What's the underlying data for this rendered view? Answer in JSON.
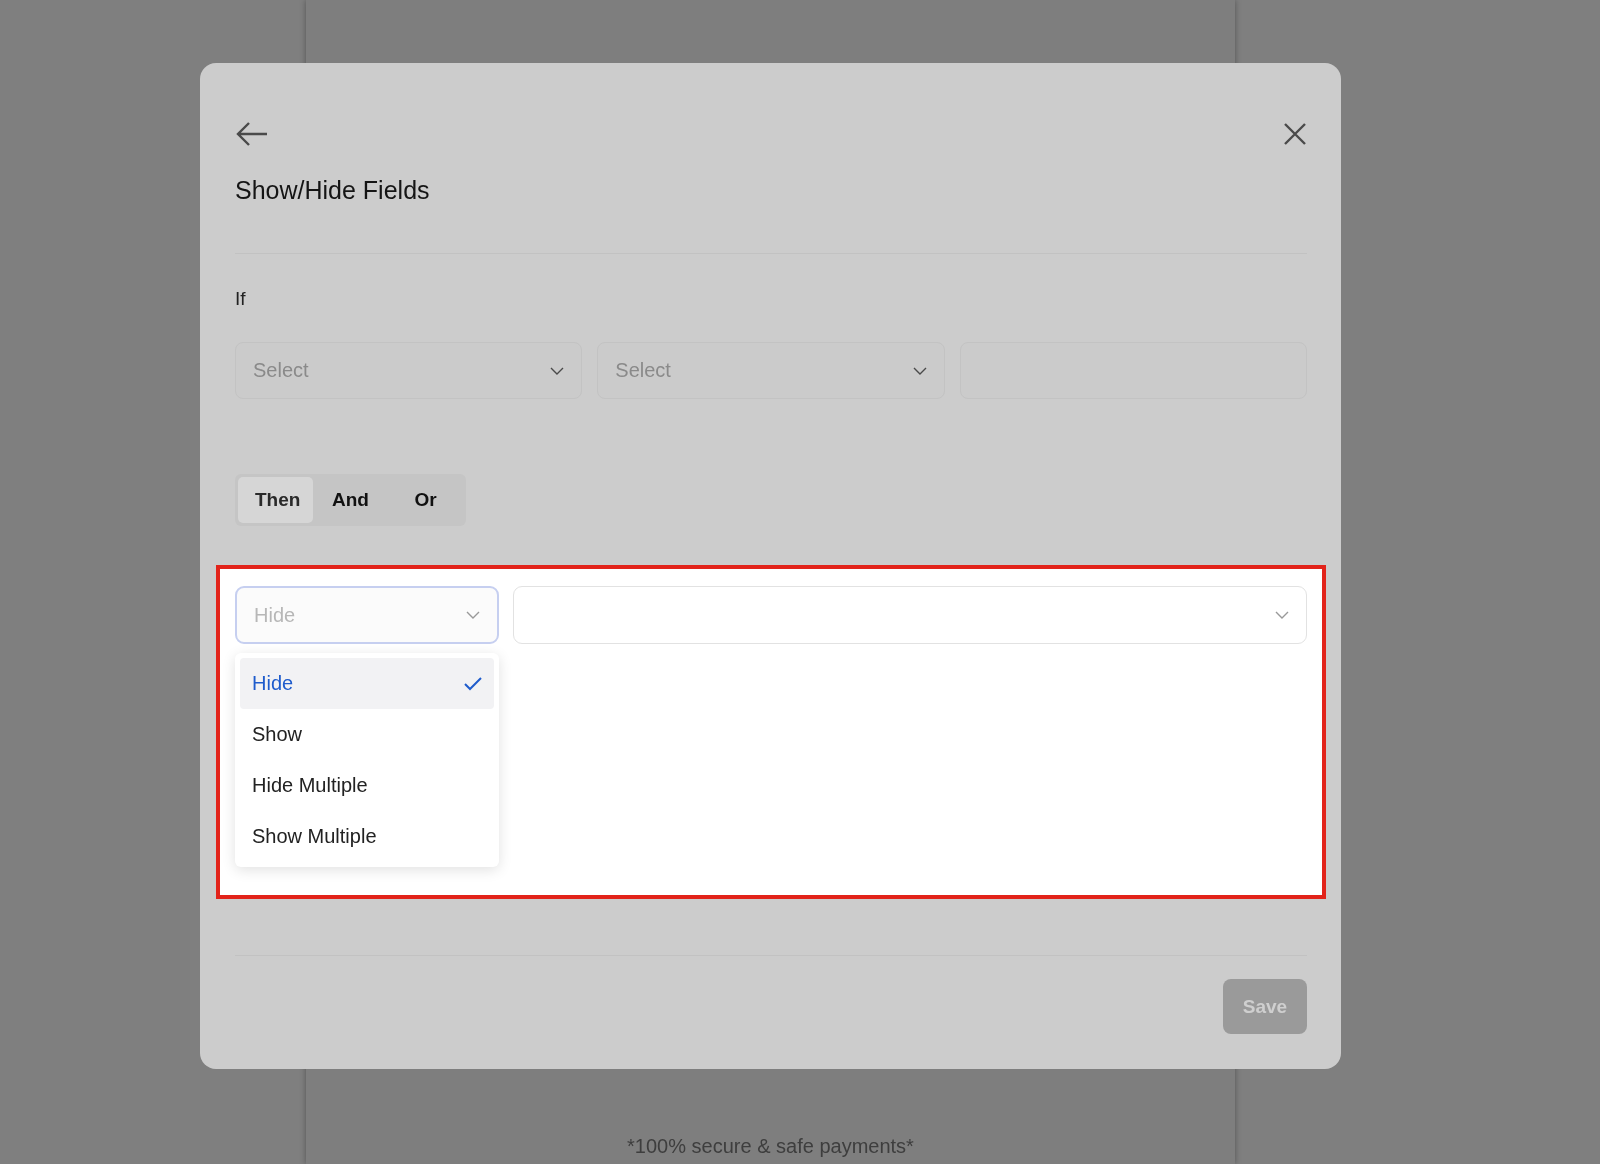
{
  "background_page": {
    "footer_note": "*100% secure & safe payments*"
  },
  "dialog": {
    "title": "Show/Hide Fields",
    "condition_label": "If",
    "condition_fields": [
      {
        "kind": "select",
        "placeholder": "Select"
      },
      {
        "kind": "select",
        "placeholder": "Select"
      },
      {
        "kind": "text"
      }
    ],
    "connectors": [
      {
        "label": "Then",
        "selected": true
      },
      {
        "label": "And",
        "selected": false
      },
      {
        "label": "Or",
        "selected": false
      }
    ],
    "action_select": {
      "value": "Hide",
      "expanded": true,
      "options": [
        {
          "label": "Hide",
          "selected": true
        },
        {
          "label": "Show",
          "selected": false
        },
        {
          "label": "Hide Multiple",
          "selected": false
        },
        {
          "label": "Show Multiple",
          "selected": false
        }
      ]
    },
    "save_button": "Save"
  }
}
